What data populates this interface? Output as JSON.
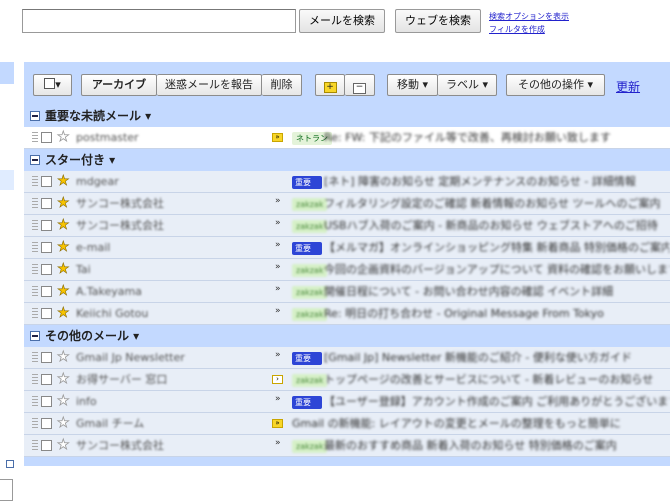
{
  "header": {
    "search_mail_button": "メールを検索",
    "search_web_button": "ウェブを検索",
    "links": [
      "検索オプションを表示",
      "フィルタを作成"
    ]
  },
  "toolbar": {
    "archive": "アーカイブ",
    "spam": "迷惑メールを報告",
    "delete": "削除",
    "move": "移動 ▾",
    "label": "ラベル ▾",
    "more_actions": "その他の操作 ▾",
    "refresh": "更新"
  },
  "sections": [
    {
      "title": "重要な未読メール ▾",
      "rows": [
        {
          "sender": "postmaster",
          "starred": false,
          "unread": true,
          "marker": "important",
          "label": "ネトラン",
          "label_style": "ok",
          "subject": "Re: FW: 下記のファイル等で改善、再検討お願い致します"
        }
      ]
    },
    {
      "title": "スター付き ▾",
      "rows": [
        {
          "sender": "mdgear",
          "starred": true,
          "marker": "none",
          "label": "重要",
          "label_style": "blue",
          "subject": "[ネト] 障害のお知らせ 定期メンテナンスのお知らせ - 詳細情報"
        },
        {
          "sender": "サンコー株式会社",
          "starred": true,
          "marker": "chevron",
          "label": "zakzak",
          "label_style": "blur",
          "subject": "フィルタリング設定のご確認 新着情報のお知らせ ツールへのご案内"
        },
        {
          "sender": "サンコー株式会社",
          "starred": true,
          "marker": "chevron",
          "label": "zakzak",
          "label_style": "blur",
          "subject": "USBハブ入荷のご案内 - 新商品のお知らせ ウェブストアへのご招待"
        },
        {
          "sender": "e-mail",
          "starred": true,
          "marker": "chevron",
          "label": "重要",
          "label_style": "blue",
          "subject": "【メルマガ】オンラインショッピング特集 新着商品 特別価格のご案内"
        },
        {
          "sender": "Tai",
          "starred": true,
          "marker": "chevron",
          "label": "zakzak",
          "label_style": "blur",
          "subject": "今回の企画資料のバージョンアップについて 資料の確認をお願いします"
        },
        {
          "sender": "A.Takeyama",
          "starred": true,
          "marker": "chevron",
          "label": "zakzak",
          "label_style": "blur",
          "subject": "開催日程について - お問い合わせ内容の確認 イベント詳細"
        },
        {
          "sender": "Keiichi Gotou",
          "starred": true,
          "marker": "chevron",
          "label": "zakzak",
          "label_style": "blur",
          "subject": "Re: 明日の打ち合わせ - Original Message From Tokyo"
        }
      ]
    },
    {
      "title": "その他のメール ▾",
      "rows": [
        {
          "sender": "Gmail Jp Newsletter",
          "starred": false,
          "marker": "chevron",
          "label": "重要",
          "label_style": "blue",
          "subject": "[Gmail Jp] Newsletter 新機能のご紹介 - 便利な使い方ガイド"
        },
        {
          "sender": "お得サーバー 窓口",
          "starred": false,
          "marker": "important-outline",
          "label": "zakzak",
          "label_style": "blur",
          "subject": "トップページの改善とサービスについて - 新着レビューのお知らせ"
        },
        {
          "sender": "info",
          "starred": false,
          "marker": "chevron",
          "label": "重要",
          "label_style": "blue",
          "subject": "【ユーザー登録】アカウント作成のご案内 ご利用ありがとうございます"
        },
        {
          "sender": "Gmail チーム",
          "starred": false,
          "marker": "important",
          "label": "",
          "label_style": "",
          "subject": "Gmail の新機能: レイアウトの変更とメールの整理をもっと簡単に"
        },
        {
          "sender": "サンコー株式会社",
          "starred": false,
          "marker": "chevron",
          "label": "zakzak",
          "label_style": "blur",
          "subject": "最新のおすすめ商品 新着入荷のお知らせ 特別価格のご案内"
        }
      ]
    }
  ],
  "colors": {
    "accent": "#c3d9ff",
    "read_row": "#e8eef7",
    "link": "#2222cc",
    "star": "#f8c400"
  }
}
